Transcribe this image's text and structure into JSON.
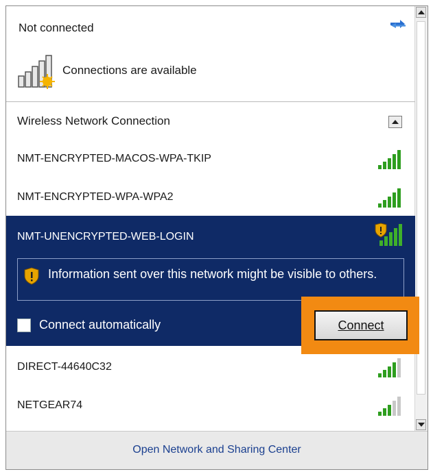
{
  "header": {
    "status": "Not connected",
    "availability": "Connections are available"
  },
  "section": {
    "title": "Wireless Network Connection"
  },
  "networks": [
    {
      "name": "NMT-ENCRYPTED-MACOS-WPA-TKIP"
    },
    {
      "name": "NMT-ENCRYPTED-WPA-WPA2"
    },
    {
      "name": "NMT-UNENCRYPTED-WEB-LOGIN"
    },
    {
      "name": "DIRECT-44640C32"
    },
    {
      "name": "NETGEAR74"
    }
  ],
  "selected": {
    "warning": "Information sent over this network might be visible to others.",
    "auto_connect_label": "Connect automatically",
    "auto_connect_checked": false,
    "connect_label": "Connect"
  },
  "footer": {
    "link": "Open Network and Sharing Center"
  },
  "colors": {
    "selected_bg": "#0f2a66",
    "highlight": "#f28a12",
    "signal_on": "#2e9e1f",
    "signal_off": "#c8c8c8"
  }
}
